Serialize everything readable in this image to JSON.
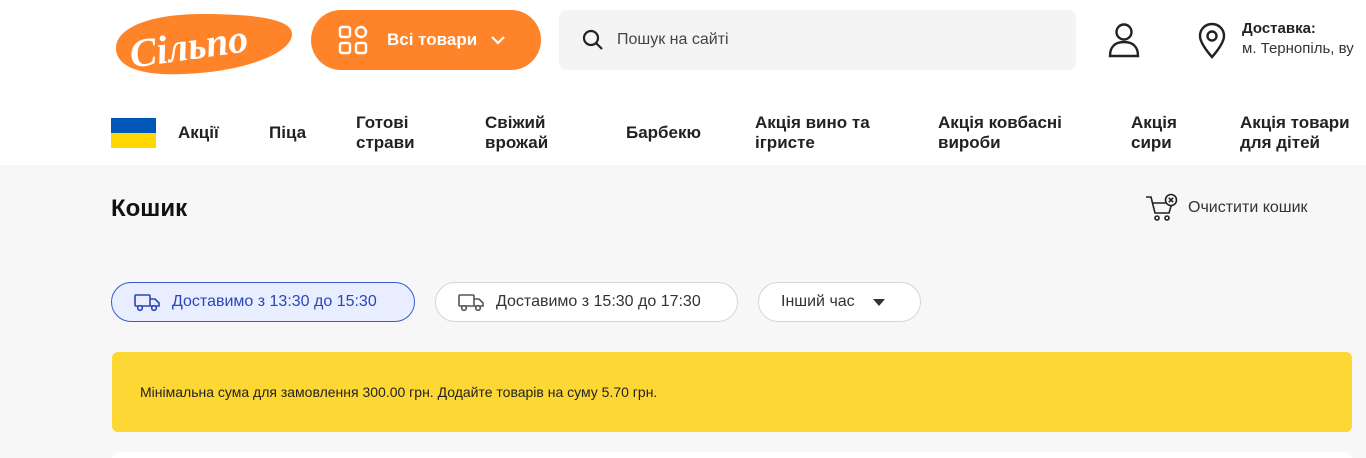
{
  "brand": {
    "logo_text": "Сільпо",
    "accent": "#ff8329"
  },
  "header": {
    "all_goods_label": "Всі товари",
    "search_placeholder": "Пошук на сайті",
    "delivery_title": "Доставка:",
    "delivery_address": "м. Тернопіль, ву"
  },
  "nav": {
    "items": [
      {
        "label": "Акції"
      },
      {
        "label": "Піца"
      },
      {
        "line1": "Готові",
        "line2": "страви"
      },
      {
        "line1": "Свіжий",
        "line2": "врожай"
      },
      {
        "label": "Барбекю"
      },
      {
        "line1": "Акція вино та",
        "line2": "ігристе"
      },
      {
        "line1": "Акція ковбасні",
        "line2": "вироби"
      },
      {
        "line1": "Акція",
        "line2": "сири"
      },
      {
        "line1": "Акція товари",
        "line2": "для дітей"
      }
    ]
  },
  "cart": {
    "title": "Кошик",
    "clear_label": "Очистити кошик",
    "slots": [
      {
        "label": "Доставимо з 13:30 до 15:30",
        "active": true
      },
      {
        "label": "Доставимо з 15:30 до 17:30",
        "active": false
      }
    ],
    "other_time_label": "Інший час",
    "notice": "Мінімальна сума для замовлення 300.00 грн. Додайте товарів на суму 5.70 грн."
  },
  "colors": {
    "notice_bg": "#fdd835",
    "active_slot": "#3a5bcf",
    "flag_blue": "#0057b8",
    "flag_yellow": "#ffd700"
  }
}
